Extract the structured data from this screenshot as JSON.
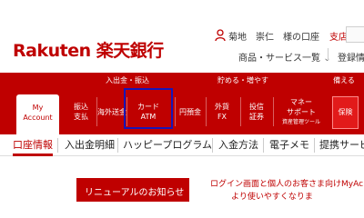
{
  "header": {
    "logo": "Rakuten 楽天銀行",
    "user_greeting": "菊地　崇仁　様の口座",
    "branch_label": "支店",
    "services_link": "商品・サービス一覧",
    "register_link": "登録情"
  },
  "categories": [
    {
      "label": "入出金・振込"
    },
    {
      "label": "貯める・増やす"
    },
    {
      "label": "備える"
    }
  ],
  "nav": {
    "my_account": [
      "My",
      "Account"
    ],
    "items": [
      {
        "lines": [
          "振込",
          "支払"
        ]
      },
      {
        "lines": [
          "海外送金"
        ]
      },
      {
        "lines": [
          "カード",
          "ATM"
        ]
      },
      {
        "lines": [
          "円預金"
        ]
      },
      {
        "lines": [
          "外貨",
          "FX"
        ]
      },
      {
        "lines": [
          "投信",
          "証券"
        ]
      },
      {
        "lines": [
          "マネー",
          "サポート",
          "資産管理ツール"
        ]
      }
    ],
    "insurance": "保険"
  },
  "subtabs": [
    "口座情報",
    "入出金明細",
    "ハッピープログラム",
    "入金方法",
    "電子メモ",
    "提携サービ"
  ],
  "notice": {
    "title": "リニューアルのお知らせ",
    "line1": "ログイン画面と個人のお客さま向けMyAc",
    "line2": "より使いやすくなりま"
  },
  "colors": {
    "brand_red": "#bf0000",
    "highlight_border": "#1616b8"
  }
}
